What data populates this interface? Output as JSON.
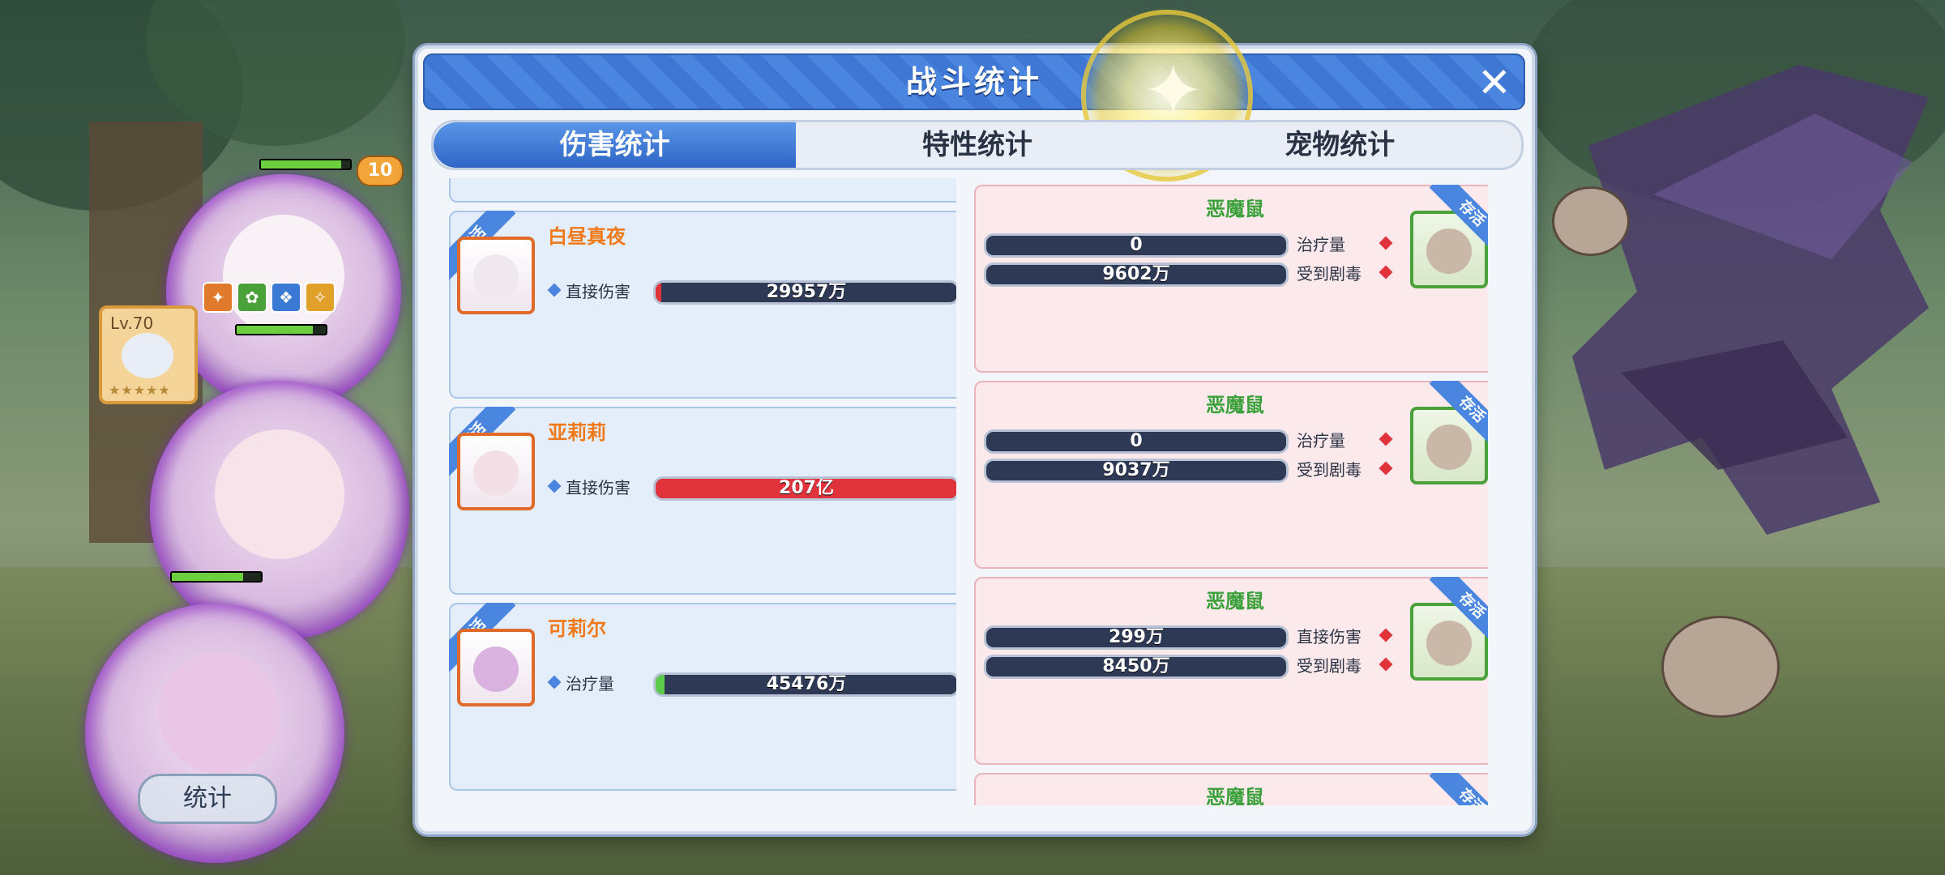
{
  "panel": {
    "title": "战斗统计",
    "close_glyph": "✕",
    "tabs": [
      {
        "label": "伤害统计",
        "active": true
      },
      {
        "label": "特性统计",
        "active": false
      },
      {
        "label": "宠物统计",
        "active": false
      }
    ]
  },
  "left_hud": {
    "level_badge": "10",
    "pet_level": "Lv.70",
    "pet_stars": "★★★★★",
    "stat_button": "统计"
  },
  "allies": [
    {
      "name": "白昼真夜",
      "status": "存活",
      "stat_label": "直接伤害",
      "value": "29957万",
      "fill": 0.02,
      "fill_color": "#e0333c",
      "avatar_color": "#efe8ee"
    },
    {
      "name": "亚莉莉",
      "status": "存活",
      "stat_label": "直接伤害",
      "value": "207亿",
      "fill": 1.0,
      "fill_color": "#e0333c",
      "avatar_color": "#f3e0e6"
    },
    {
      "name": "可莉尔",
      "status": "存活",
      "stat_label": "治疗量",
      "value": "45476万",
      "fill": 0.03,
      "fill_color": "#5ccc4a",
      "avatar_color": "#d9b2e0"
    }
  ],
  "enemies": [
    {
      "name": "恶魔鼠",
      "status": "存活",
      "stats": [
        {
          "label": "治疗量",
          "value": "0"
        },
        {
          "label": "受到剧毒",
          "value": "9602万"
        }
      ]
    },
    {
      "name": "恶魔鼠",
      "status": "存活",
      "stats": [
        {
          "label": "治疗量",
          "value": "0"
        },
        {
          "label": "受到剧毒",
          "value": "9037万"
        }
      ]
    },
    {
      "name": "恶魔鼠",
      "status": "存活",
      "stats": [
        {
          "label": "直接伤害",
          "value": "299万"
        },
        {
          "label": "受到剧毒",
          "value": "8450万"
        }
      ]
    },
    {
      "name": "恶魔鼠",
      "status": "存活",
      "stats": []
    }
  ]
}
